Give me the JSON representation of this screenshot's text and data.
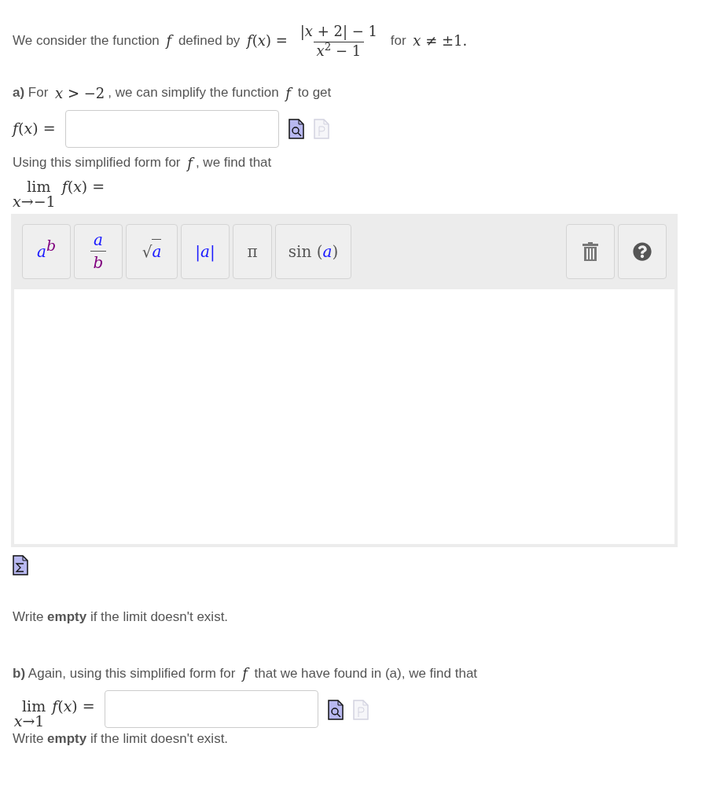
{
  "intro": {
    "parts": [
      {
        "kind": "text",
        "text": "We consider the function "
      },
      {
        "kind": "math",
        "text": "*f*"
      },
      {
        "kind": "text",
        "text": " defined by "
      },
      {
        "kind": "math",
        "text": "*f*(*x*) ="
      },
      {
        "kind": "fraction",
        "numerator": "|*x* + 2| − 1",
        "denominator": "*x*$^{2}$ − 1"
      },
      {
        "kind": "text",
        "text": " for "
      },
      {
        "kind": "math",
        "text": "*x* ≠ ±1."
      }
    ]
  },
  "part_a": {
    "intro": {
      "parts": [
        {
          "kind": "bold",
          "text": "a)"
        },
        {
          "kind": "text",
          "text": " For "
        },
        {
          "kind": "math",
          "text": "*x* > −2"
        },
        {
          "kind": "text",
          "text": ", we can simplify the function "
        },
        {
          "kind": "math",
          "text": "*f*"
        },
        {
          "kind": "text",
          "text": " to get"
        }
      ]
    },
    "answer": {
      "label": "*f*(*x*) =",
      "tools": [
        {
          "kind": "preview",
          "disabled": false
        },
        {
          "kind": "paste",
          "disabled": true
        }
      ]
    },
    "followup": {
      "parts": [
        {
          "kind": "text",
          "text": "Using this simplified form for "
        },
        {
          "kind": "math",
          "text": "*f*"
        },
        {
          "kind": "text",
          "text": ", we find that"
        }
      ]
    },
    "limit": {
      "lim": "lim",
      "sub": "*x*→−1",
      "func": "*f*(*x*) ="
    },
    "editor": {
      "toolbar": [
        {
          "kind": "power",
          "base": "a",
          "exponent": "b"
        },
        {
          "kind": "fraction",
          "numerator": "a",
          "denominator": "b"
        },
        {
          "kind": "sqrt",
          "symbol": "√",
          "arg": "a"
        },
        {
          "kind": "abs",
          "left": "|",
          "arg": "a",
          "right": "|"
        },
        {
          "kind": "symbol",
          "text": "π"
        },
        {
          "kind": "function",
          "left": "sin (",
          "arg": "a",
          "right": ")"
        }
      ],
      "actions": [
        {
          "kind": "trash"
        },
        {
          "kind": "help"
        }
      ]
    },
    "note": "Write **empty** if the limit doesn't exist."
  },
  "part_b": {
    "intro": {
      "parts": [
        {
          "kind": "bold",
          "text": "b)"
        },
        {
          "kind": "text",
          "text": " Again, using this simplified form for "
        },
        {
          "kind": "math",
          "text": "*f*"
        },
        {
          "kind": "text",
          "text": " that we have found in (a), we find that"
        }
      ]
    },
    "limit": {
      "lim": "lim",
      "sub": "*x*→1",
      "func": "*f*(*x*) ="
    },
    "answer": {
      "tools": [
        {
          "kind": "preview",
          "disabled": false
        },
        {
          "kind": "paste",
          "disabled": true
        }
      ]
    },
    "note": "Write **empty** if the limit doesn't exist."
  }
}
